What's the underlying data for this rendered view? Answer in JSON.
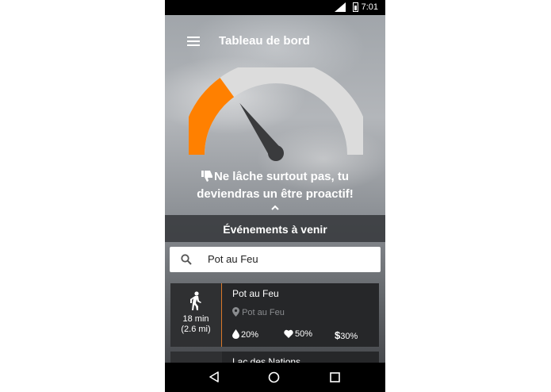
{
  "status_bar": {
    "time": "7:01",
    "signal_label": "H"
  },
  "app_bar": {
    "title": "Tableau de bord"
  },
  "gauge": {
    "level": 0.3,
    "fill_color": "#ff8000",
    "track_color": "#dcdcdc",
    "needle_color": "#3a3b3d"
  },
  "message": {
    "line1": "Ne lâche surtout pas, tu",
    "line2": "deviendras un être proactif!"
  },
  "events": {
    "header": "Événements à venir",
    "search": {
      "value": "Pot au Feu",
      "placeholder": ""
    },
    "items": [
      {
        "name": "Pot au Feu",
        "location": "Pot au Feu",
        "walk_time": "18 min",
        "distance": "(2.6 mi)",
        "stats": {
          "drop": "20%",
          "heart": "50%",
          "dollar": "30%"
        }
      },
      {
        "name": "Lac des Nations"
      }
    ]
  },
  "colors": {
    "accent": "#ff8000"
  },
  "icons": {
    "menu": "menu-icon",
    "search": "search-icon",
    "walk": "walk-icon",
    "pin": "pin-icon",
    "drop": "drop-icon",
    "heart": "heart-icon",
    "dollar": "dollar-icon",
    "thumb": "thumbs-down-icon"
  }
}
